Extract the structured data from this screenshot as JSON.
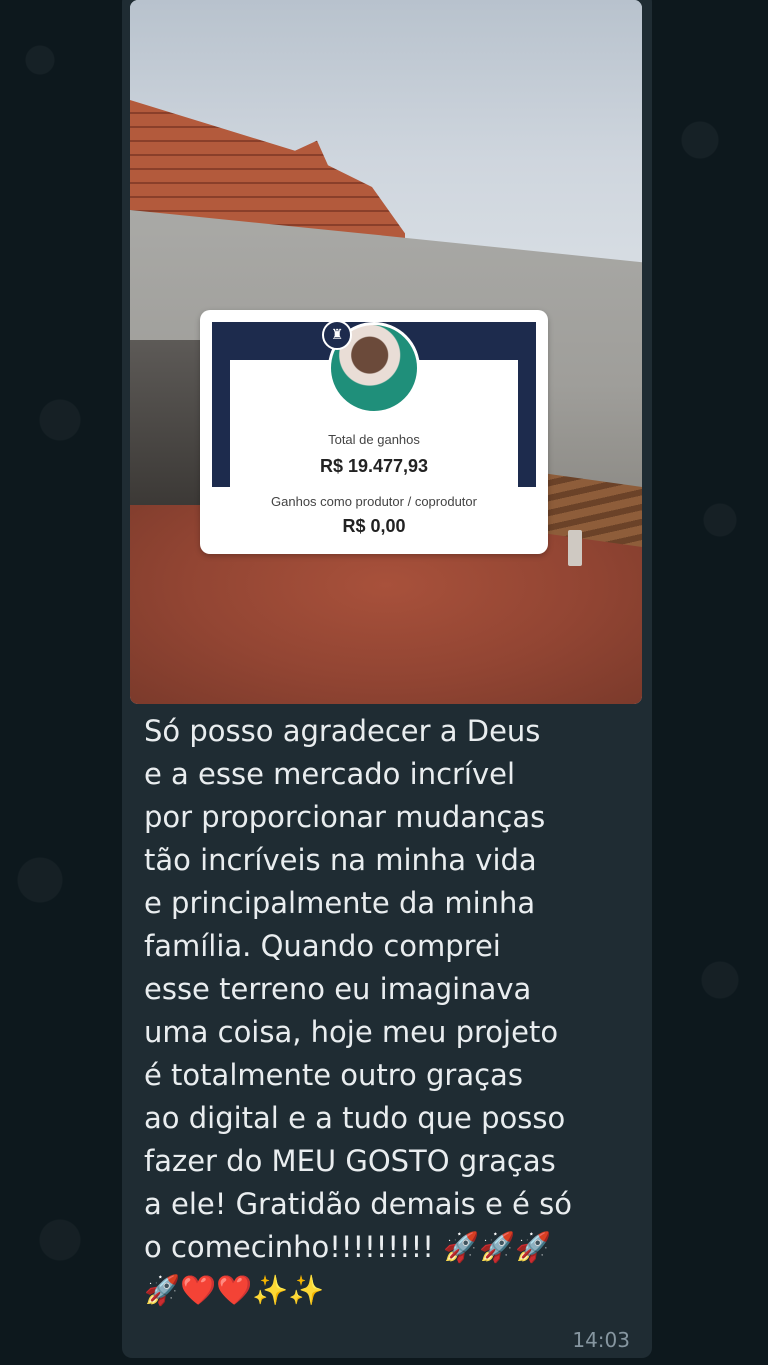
{
  "message": {
    "text": "Só posso agradecer a Deus\ne a esse mercado incrível\npor proporcionar mudanças\ntão incríveis na minha vida\ne principalmente da minha\nfamília. Quando comprei\nesse terreno eu imaginava\numa coisa, hoje meu projeto\né totalmente outro graças\nao digital e a tudo que posso\nfazer do MEU GOSTO graças\na ele! Gratidão demais e é só\no comecinho!!!!!!!!! 🚀🚀🚀\n🚀❤️❤️✨✨",
    "time": "14:03"
  },
  "earnings_card": {
    "total_label": "Total de ganhos",
    "total_value": "R$ 19.477,93",
    "producer_label": "Ganhos como produtor / coprodutor",
    "producer_value": "R$ 0,00"
  },
  "colors": {
    "bubble": "#1f2c33",
    "chat_background": "#0d181d",
    "message_text": "#e9edef",
    "timestamp": "#8696a0",
    "card_header": "#1d2b4d"
  }
}
